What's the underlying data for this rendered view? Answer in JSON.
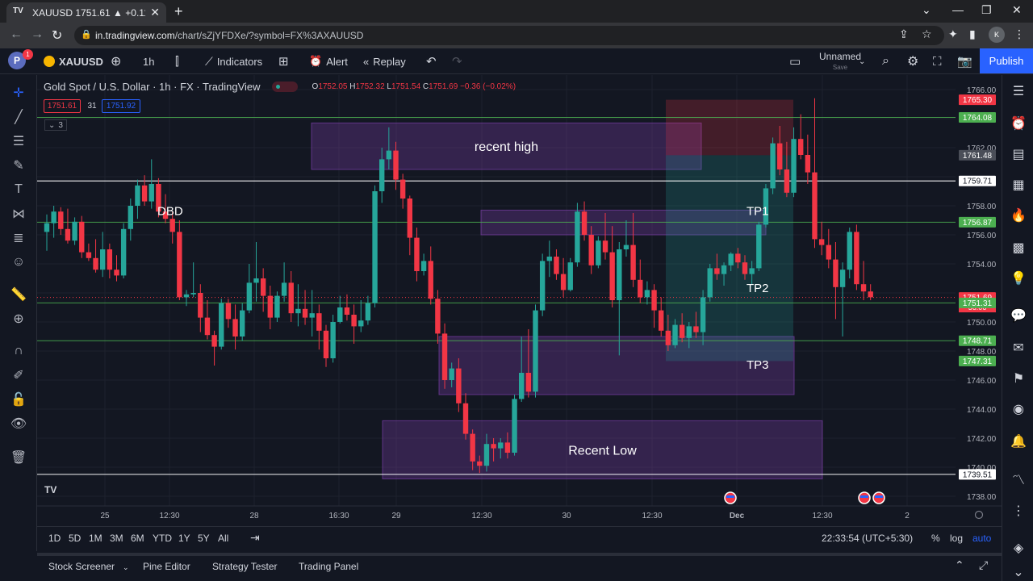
{
  "browser": {
    "tab_title": "XAUUSD 1751.61 ▲ +0.11% Unna",
    "url_host": "in.tradingview.com",
    "url_path": "/chart/sZjYFDXe/?symbol=FX%3AXAUUSD"
  },
  "toolbar": {
    "notification_count": "1",
    "symbol": "XAUUSD",
    "interval": "1h",
    "indicators_label": "Indicators",
    "alert_label": "Alert",
    "replay_label": "Replay",
    "layout_name": "Unnamed",
    "layout_sub": "Save",
    "publish_label": "Publish"
  },
  "legend": {
    "title": "Gold Spot / U.S. Dollar · 1h · FX  · TradingView",
    "open_k": "O",
    "open": "1752.05",
    "high_k": "H",
    "high": "1752.32",
    "low_k": "L",
    "low": "1751.54",
    "close_k": "C",
    "close": "1751.69",
    "change": "−0.36 (−0.02%)",
    "bid": "1751.61",
    "spread": "31",
    "ask": "1751.92",
    "collapse": "3"
  },
  "colors": {
    "up": "#26a69a",
    "down": "#f23645",
    "zone": "#7b3fa8",
    "background": "#131722",
    "accent": "#2962ff"
  },
  "chart_data": {
    "type": "candlestick",
    "ylim": [
      1737,
      1767
    ],
    "y_ticks": [
      "1766.00",
      "1762.00",
      "1758.00",
      "1756.00",
      "1754.00",
      "1750.00",
      "1748.00",
      "1746.00",
      "1744.00",
      "1742.00",
      "1740.00",
      "1738.00"
    ],
    "x_labels": [
      "25",
      "12:30",
      "28",
      "16:30",
      "29",
      "12:30",
      "30",
      "12:30",
      "Dec",
      "12:30",
      "2"
    ],
    "price_tags": [
      {
        "value": "1765.30",
        "y": 1765.3,
        "color": "#f23645"
      },
      {
        "value": "1764.08",
        "y": 1764.08,
        "color": "#4caf50"
      },
      {
        "value": "1761.48",
        "y": 1761.48,
        "color": "#4a4e58"
      },
      {
        "value": "1759.71",
        "y": 1759.71,
        "color": "#ffffff"
      },
      {
        "value": "1756.87",
        "y": 1756.87,
        "color": "#4caf50"
      },
      {
        "value": "1751.69",
        "y": 1751.69,
        "color": "#f23645"
      },
      {
        "value": "1751.31",
        "y": 1751.31,
        "color": "#4caf50"
      },
      {
        "value": "1748.71",
        "y": 1748.71,
        "color": "#4caf50"
      },
      {
        "value": "1747.31",
        "y": 1747.31,
        "color": "#4caf50"
      },
      {
        "value": "1739.51",
        "y": 1739.51,
        "color": "#ffffff"
      }
    ],
    "countdown": "56:06",
    "zones": [
      {
        "label": "recent high",
        "top": 1763.7,
        "bottom": 1760.5
      },
      {
        "label": "",
        "top": 1757.7,
        "bottom": 1756.0
      },
      {
        "label": "",
        "top": 1749.0,
        "bottom": 1745.0
      },
      {
        "label": "Recent Low",
        "top": 1743.2,
        "bottom": 1739.2
      }
    ],
    "annotations": [
      {
        "text": "DBD",
        "y": 1757.7
      },
      {
        "text": "TP1",
        "y": 1757.7
      },
      {
        "text": "TP2",
        "y": 1752.4
      },
      {
        "text": "TP3",
        "y": 1747.1
      }
    ],
    "position": {
      "entry": 1761.48,
      "stop": 1765.3,
      "target": 1747.31
    },
    "candles": [
      [
        1756.2,
        1757.4,
        1754.9,
        1756.8
      ],
      [
        1756.8,
        1758.0,
        1755.8,
        1757.6
      ],
      [
        1757.6,
        1757.9,
        1756.0,
        1756.4
      ],
      [
        1756.4,
        1757.8,
        1755.4,
        1755.6
      ],
      [
        1755.6,
        1757.2,
        1755.3,
        1756.9
      ],
      [
        1756.9,
        1757.3,
        1754.4,
        1754.8
      ],
      [
        1754.8,
        1755.4,
        1754.2,
        1754.4
      ],
      [
        1754.4,
        1755.7,
        1753.4,
        1753.6
      ],
      [
        1753.6,
        1756.2,
        1753.1,
        1755.0
      ],
      [
        1755.0,
        1755.4,
        1753.0,
        1753.6
      ],
      [
        1753.6,
        1754.6,
        1752.8,
        1753.2
      ],
      [
        1753.2,
        1756.8,
        1753.0,
        1756.4
      ],
      [
        1756.4,
        1758.5,
        1755.6,
        1758.0
      ],
      [
        1758.0,
        1759.8,
        1757.1,
        1759.4
      ],
      [
        1759.4,
        1760.1,
        1758.0,
        1758.3
      ],
      [
        1758.3,
        1761.2,
        1757.8,
        1759.5
      ],
      [
        1759.5,
        1759.9,
        1757.2,
        1757.6
      ],
      [
        1757.6,
        1758.8,
        1756.8,
        1757.1
      ],
      [
        1757.1,
        1757.6,
        1755.4,
        1756.2
      ],
      [
        1756.2,
        1757.0,
        1751.5,
        1751.7
      ],
      [
        1751.7,
        1752.2,
        1751.1,
        1751.9
      ],
      [
        1751.9,
        1754.1,
        1751.7,
        1752.0
      ],
      [
        1752.0,
        1752.6,
        1749.3,
        1750.3
      ],
      [
        1750.3,
        1751.5,
        1748.8,
        1749.1
      ],
      [
        1749.1,
        1749.4,
        1747.0,
        1748.3
      ],
      [
        1748.3,
        1751.6,
        1748.1,
        1751.3
      ],
      [
        1751.3,
        1751.6,
        1749.6,
        1750.2
      ],
      [
        1750.2,
        1751.2,
        1748.1,
        1749.0
      ],
      [
        1749.0,
        1751.3,
        1748.7,
        1750.8
      ],
      [
        1750.8,
        1754.0,
        1750.6,
        1752.7
      ],
      [
        1752.7,
        1755.5,
        1751.4,
        1753.0
      ],
      [
        1753.0,
        1753.7,
        1750.7,
        1751.8
      ],
      [
        1751.8,
        1752.5,
        1749.5,
        1750.3
      ],
      [
        1750.3,
        1752.1,
        1750.0,
        1751.8
      ],
      [
        1751.8,
        1754.1,
        1751.4,
        1752.7
      ],
      [
        1752.7,
        1753.5,
        1750.0,
        1750.6
      ],
      [
        1750.6,
        1752.6,
        1749.7,
        1750.9
      ],
      [
        1750.9,
        1752.2,
        1749.8,
        1750.3
      ],
      [
        1750.3,
        1752.2,
        1749.0,
        1750.6
      ],
      [
        1750.6,
        1751.2,
        1748.1,
        1749.4
      ],
      [
        1749.4,
        1749.8,
        1746.9,
        1747.5
      ],
      [
        1747.5,
        1750.5,
        1747.2,
        1750.0
      ],
      [
        1750.0,
        1751.8,
        1749.9,
        1751.0
      ],
      [
        1751.0,
        1751.9,
        1750.1,
        1750.5
      ],
      [
        1750.5,
        1751.2,
        1748.5,
        1749.7
      ],
      [
        1749.7,
        1751.5,
        1749.3,
        1750.1
      ],
      [
        1750.1,
        1751.8,
        1749.8,
        1751.3
      ],
      [
        1751.3,
        1759.4,
        1751.0,
        1759.0
      ],
      [
        1759.0,
        1762.0,
        1758.2,
        1761.2
      ],
      [
        1761.2,
        1763.4,
        1760.5,
        1761.8
      ],
      [
        1761.8,
        1762.4,
        1759.1,
        1759.8
      ],
      [
        1759.8,
        1760.2,
        1757.8,
        1758.5
      ],
      [
        1758.5,
        1758.7,
        1754.6,
        1755.8
      ],
      [
        1755.8,
        1756.5,
        1752.8,
        1753.5
      ],
      [
        1753.5,
        1754.7,
        1753.2,
        1754.2
      ],
      [
        1754.2,
        1755.2,
        1751.2,
        1751.6
      ],
      [
        1751.6,
        1752.2,
        1748.5,
        1749.2
      ],
      [
        1749.2,
        1749.9,
        1745.4,
        1746.0
      ],
      [
        1746.0,
        1747.2,
        1745.5,
        1746.8
      ],
      [
        1746.8,
        1747.5,
        1743.8,
        1744.4
      ],
      [
        1744.4,
        1745.1,
        1741.9,
        1742.3
      ],
      [
        1742.3,
        1742.6,
        1739.8,
        1740.4
      ],
      [
        1740.4,
        1740.8,
        1739.6,
        1740.1
      ],
      [
        1740.1,
        1742.3,
        1739.7,
        1741.6
      ],
      [
        1741.6,
        1742.0,
        1740.4,
        1741.3
      ],
      [
        1741.3,
        1742.0,
        1740.6,
        1741.7
      ],
      [
        1741.7,
        1742.4,
        1740.6,
        1741.0
      ],
      [
        1741.0,
        1745.0,
        1740.8,
        1744.7
      ],
      [
        1744.7,
        1749.0,
        1744.5,
        1746.5
      ],
      [
        1746.5,
        1749.5,
        1744.8,
        1745.2
      ],
      [
        1745.2,
        1751.2,
        1744.8,
        1750.8
      ],
      [
        1750.8,
        1754.7,
        1750.4,
        1754.2
      ],
      [
        1754.2,
        1755.6,
        1753.1,
        1754.5
      ],
      [
        1754.5,
        1755.0,
        1752.9,
        1753.3
      ],
      [
        1753.3,
        1754.4,
        1751.7,
        1752.2
      ],
      [
        1752.2,
        1754.4,
        1752.1,
        1754.1
      ],
      [
        1754.1,
        1758.2,
        1753.8,
        1757.6
      ],
      [
        1757.6,
        1758.3,
        1755.6,
        1756.0
      ],
      [
        1756.0,
        1756.6,
        1753.3,
        1753.9
      ],
      [
        1753.9,
        1755.9,
        1753.7,
        1755.6
      ],
      [
        1755.6,
        1757.5,
        1754.3,
        1754.8
      ],
      [
        1754.8,
        1756.6,
        1751.0,
        1751.5
      ],
      [
        1751.5,
        1755.5,
        1747.7,
        1755.0
      ],
      [
        1755.0,
        1757.0,
        1754.5,
        1755.3
      ],
      [
        1755.3,
        1757.5,
        1752.4,
        1752.9
      ],
      [
        1752.9,
        1754.3,
        1751.3,
        1751.7
      ],
      [
        1751.7,
        1752.8,
        1751.2,
        1752.2
      ],
      [
        1752.2,
        1752.6,
        1749.6,
        1750.8
      ],
      [
        1750.8,
        1751.7,
        1749.0,
        1749.4
      ],
      [
        1749.4,
        1750.5,
        1748.0,
        1748.4
      ],
      [
        1748.4,
        1750.2,
        1748.2,
        1749.8
      ],
      [
        1749.8,
        1750.6,
        1748.6,
        1748.9
      ],
      [
        1748.9,
        1750.0,
        1748.2,
        1749.7
      ],
      [
        1749.7,
        1750.7,
        1748.9,
        1749.3
      ],
      [
        1749.3,
        1752.2,
        1748.4,
        1751.7
      ],
      [
        1751.7,
        1754.0,
        1751.4,
        1753.7
      ],
      [
        1753.7,
        1754.7,
        1752.9,
        1753.3
      ],
      [
        1753.3,
        1754.1,
        1752.5,
        1753.9
      ],
      [
        1753.9,
        1754.8,
        1753.5,
        1754.7
      ],
      [
        1754.7,
        1755.1,
        1753.7,
        1754.1
      ],
      [
        1754.1,
        1754.6,
        1752.9,
        1753.3
      ],
      [
        1753.3,
        1754.2,
        1752.6,
        1753.7
      ],
      [
        1753.7,
        1756.9,
        1753.5,
        1756.7
      ],
      [
        1756.7,
        1759.5,
        1756.5,
        1759.2
      ],
      [
        1759.2,
        1762.7,
        1758.8,
        1762.3
      ],
      [
        1762.3,
        1763.5,
        1760.1,
        1760.5
      ],
      [
        1760.5,
        1762.4,
        1758.6,
        1758.9
      ],
      [
        1758.9,
        1763.4,
        1758.6,
        1762.6
      ],
      [
        1762.6,
        1764.3,
        1761.2,
        1761.5
      ],
      [
        1761.5,
        1762.9,
        1759.5,
        1760.3
      ],
      [
        1760.3,
        1765.4,
        1755.1,
        1755.7
      ],
      [
        1755.7,
        1756.9,
        1754.6,
        1755.3
      ],
      [
        1755.3,
        1756.4,
        1753.7,
        1754.3
      ],
      [
        1754.3,
        1755.5,
        1750.2,
        1752.4
      ],
      [
        1752.4,
        1754.1,
        1749.0,
        1753.6
      ],
      [
        1753.6,
        1756.5,
        1753.0,
        1756.2
      ],
      [
        1756.2,
        1756.7,
        1752.2,
        1752.6
      ],
      [
        1752.6,
        1754.2,
        1751.5,
        1752.1
      ],
      [
        1752.1,
        1752.6,
        1751.5,
        1751.7
      ]
    ]
  },
  "bottombar": {
    "ranges": [
      "1D",
      "5D",
      "1M",
      "3M",
      "6M",
      "YTD",
      "1Y",
      "5Y",
      "All"
    ],
    "clock": "22:33:54 (UTC+5:30)",
    "percent": "%",
    "log": "log",
    "auto": "auto"
  },
  "footer": {
    "tabs": [
      "Stock Screener",
      "Pine Editor",
      "Strategy Tester",
      "Trading Panel"
    ]
  }
}
